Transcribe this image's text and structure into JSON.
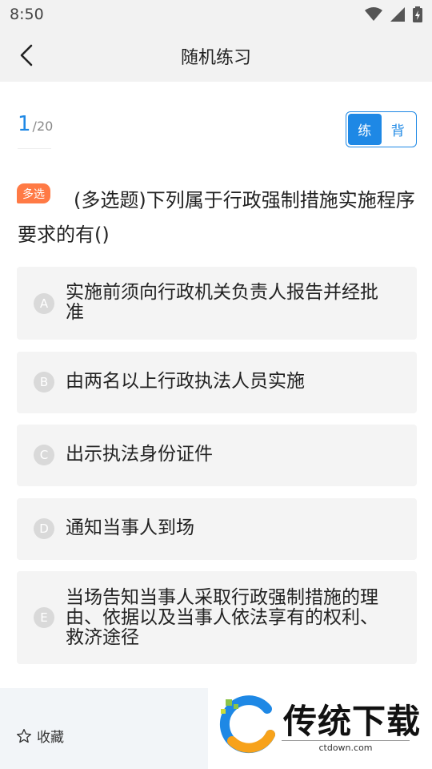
{
  "status_bar": {
    "time": "8:50",
    "icons": [
      "wifi-icon",
      "cell-signal-icon",
      "battery-icon"
    ]
  },
  "header": {
    "title": "随机练习"
  },
  "progress": {
    "current": "1",
    "total": "/20"
  },
  "mode_switch": {
    "options": [
      "练",
      "背"
    ],
    "selected": "练"
  },
  "question": {
    "type_badge": "多选",
    "text": "(多选题)下列属于行政强制措施实施程序要求的有()"
  },
  "options": [
    {
      "letter": "A",
      "text": "实施前须向行政机关负责人报告并经批准"
    },
    {
      "letter": "B",
      "text": "由两名以上行政执法人员实施"
    },
    {
      "letter": "C",
      "text": "出示执法身份证件"
    },
    {
      "letter": "D",
      "text": "通知当事人到场"
    },
    {
      "letter": "E",
      "text": "当场告知当事人采取行政强制措施的理由、依据以及当事人依法享有的权利、救济途径"
    }
  ],
  "bottom_bar": {
    "favorite_label": "收藏"
  },
  "watermark": {
    "title": "传统下载",
    "url": "ctdown.com"
  },
  "colors": {
    "accent": "#1e88e5",
    "badge": "#ff7a45",
    "option_bg": "#f4f4f4"
  }
}
